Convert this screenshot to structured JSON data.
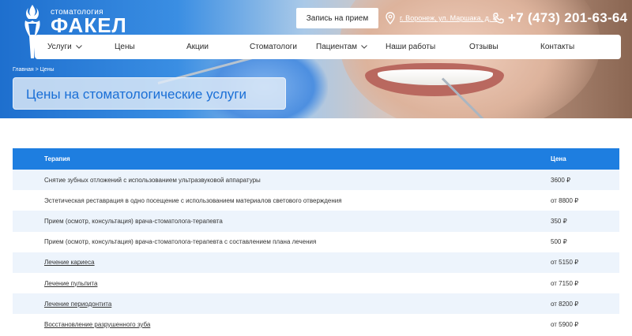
{
  "brand": {
    "subtitle": "стоматология",
    "name": "ФАКЕЛ"
  },
  "header": {
    "cta_label": "Запись на прием",
    "address": "г. Воронеж, ул. Маршака, д. 8",
    "phone": "+7 (473) 201-63-64"
  },
  "nav": {
    "items": [
      {
        "label": "Услуги",
        "dropdown": true
      },
      {
        "label": "Цены",
        "dropdown": false
      },
      {
        "label": "Акции",
        "dropdown": false
      },
      {
        "label": "Стоматологи",
        "dropdown": false
      },
      {
        "label": "Пациентам",
        "dropdown": true
      },
      {
        "label": "Наши работы",
        "dropdown": false
      },
      {
        "label": "Отзывы",
        "dropdown": false
      },
      {
        "label": "Контакты",
        "dropdown": false
      }
    ]
  },
  "breadcrumb": "Главная > Цены",
  "page_title": "Цены на стоматологические услуги",
  "table": {
    "headers": [
      "Терапия",
      "Цена"
    ],
    "rows": [
      {
        "name": "Снятие зубных отложений с использованием ультразвуковой аппаратуры",
        "price": "3600 ₽",
        "link": false
      },
      {
        "name": "Эстетическая реставрация в одно посещение с использованием материалов светового отверждения",
        "price": "от 8800 ₽",
        "link": false
      },
      {
        "name": "Прием (осмотр, консультация) врача-стоматолога-терапевта",
        "price": "350 ₽",
        "link": false
      },
      {
        "name": "Прием (осмотр, консультация) врача-стоматолога-терапевта с составлением плана лечения",
        "price": "500 ₽",
        "link": false
      },
      {
        "name": "Лечение кариеса",
        "price": "от 5150 ₽",
        "link": true
      },
      {
        "name": "Лечение пульпита",
        "price": "от 7150 ₽",
        "link": true
      },
      {
        "name": "Лечение периодонтита",
        "price": "от 8200 ₽",
        "link": true
      },
      {
        "name": "Восстановление разрушенного зуба",
        "price": "от 5900 ₽",
        "link": true
      }
    ]
  },
  "colors": {
    "accent": "#1e7ee0",
    "title": "#1a6fd6",
    "row_alt": "#edf4fc"
  }
}
